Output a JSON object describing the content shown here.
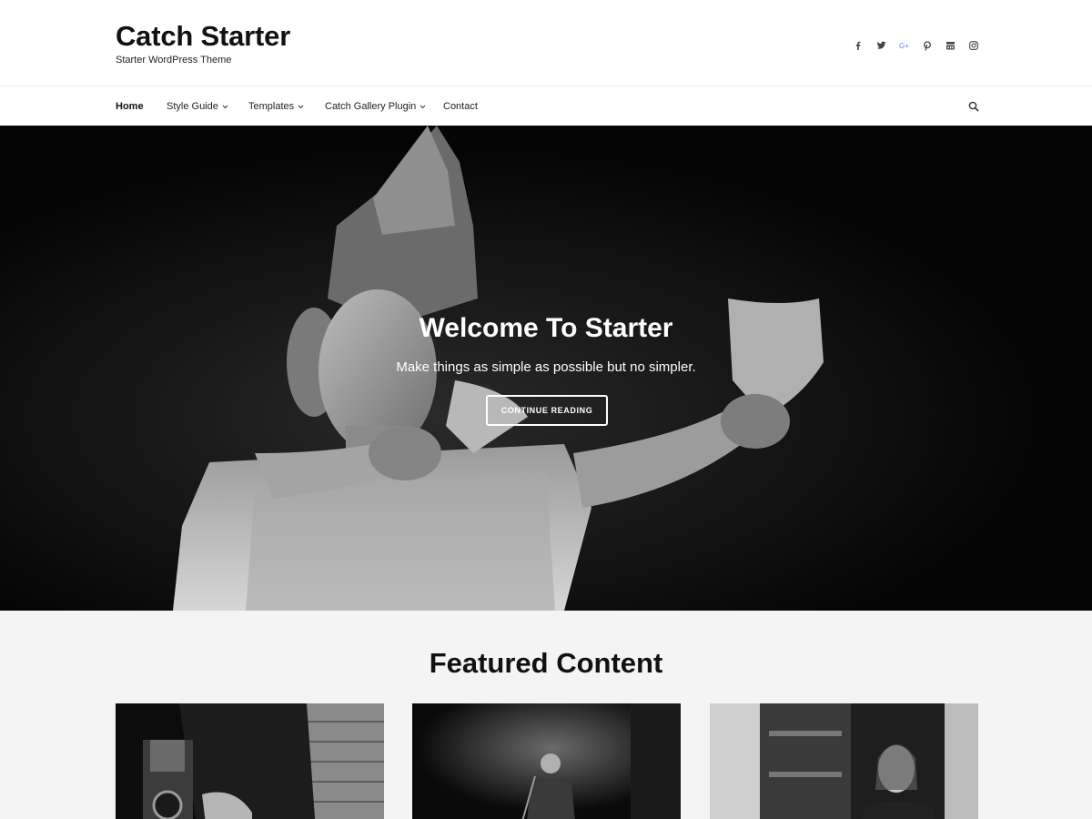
{
  "header": {
    "site_title": "Catch Starter",
    "site_description": "Starter WordPress Theme",
    "social_icons": [
      "facebook-icon",
      "twitter-icon",
      "google-plus-icon",
      "pinterest-icon",
      "youtube-icon",
      "instagram-icon"
    ]
  },
  "nav": {
    "items": [
      {
        "label": "Home",
        "active": true,
        "has_submenu": false
      },
      {
        "label": "Style Guide",
        "active": false,
        "has_submenu": true
      },
      {
        "label": "Templates",
        "active": false,
        "has_submenu": true
      },
      {
        "label": "Catch Gallery Plugin",
        "active": false,
        "has_submenu": true
      },
      {
        "label": "Contact",
        "active": false,
        "has_submenu": false
      }
    ],
    "search_icon": "search-icon"
  },
  "hero": {
    "title": "Welcome To Starter",
    "subtitle": "Make things as simple as possible but no simpler.",
    "button_label": "CONTINUE READING"
  },
  "featured": {
    "title": "Featured Content"
  },
  "colors": {
    "text": "#111111",
    "hero_bg": "#050505",
    "featured_bg": "#f4f4f4",
    "google_plus": "#5a8fd8"
  }
}
